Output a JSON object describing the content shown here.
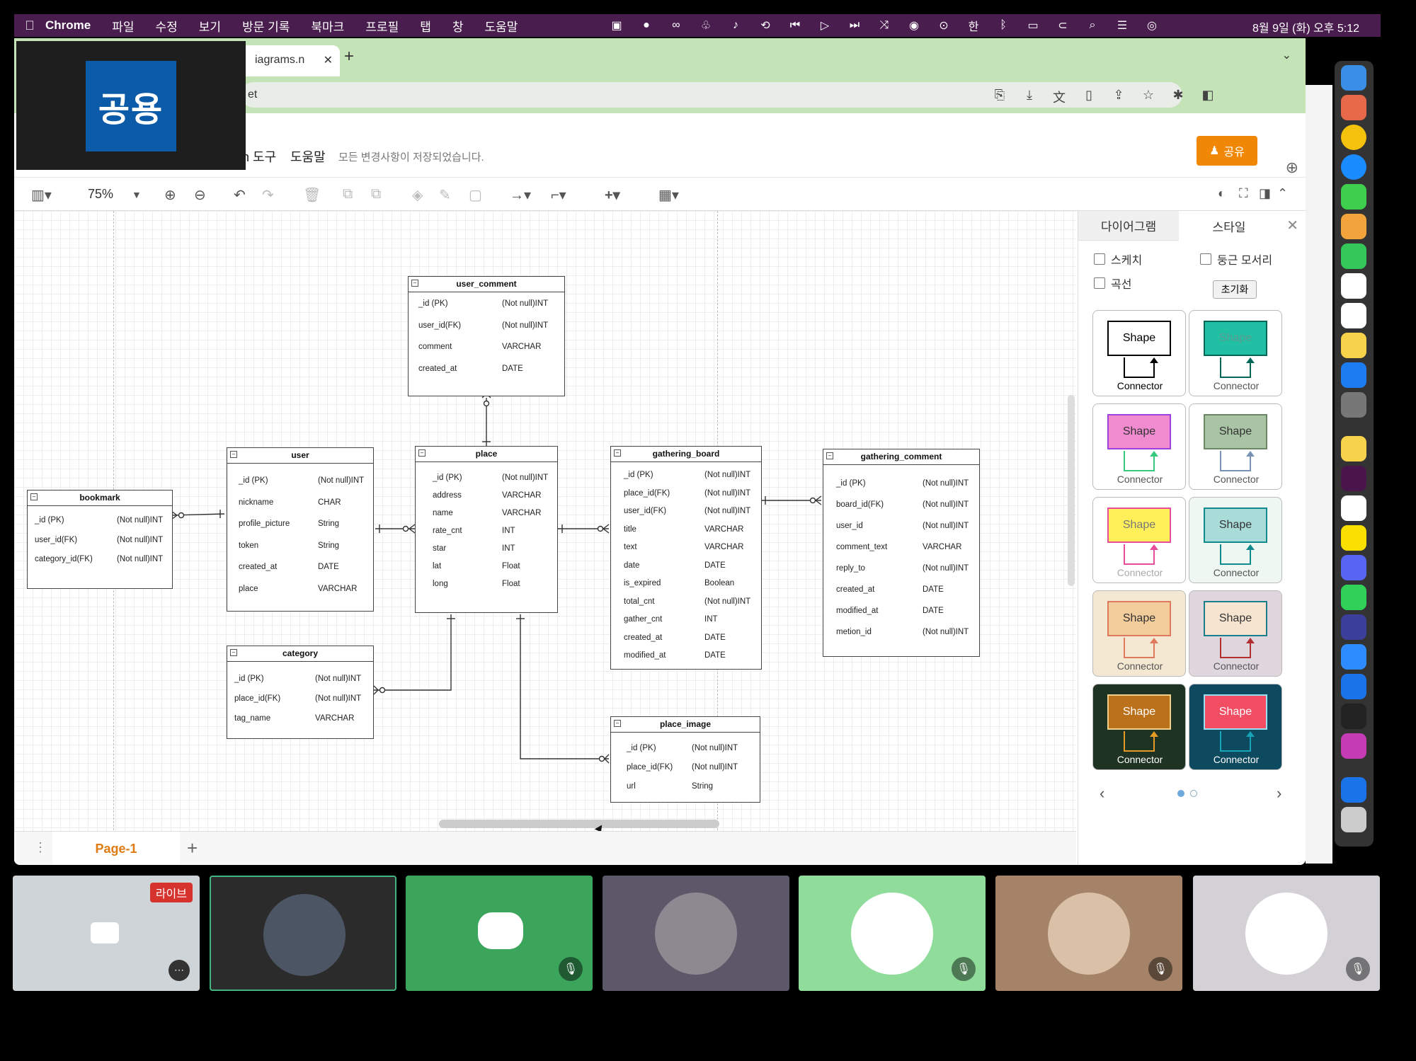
{
  "menubar": {
    "app": "Chrome",
    "items": [
      "파일",
      "수정",
      "보기",
      "방문 기록",
      "북마크",
      "프로필",
      "탭",
      "창",
      "도움말"
    ],
    "clock": "8월 9일 (화) 오후 5:12"
  },
  "browser": {
    "tab_title": "iagrams.n",
    "address": "et",
    "share_overlay": "공용"
  },
  "drawio": {
    "menu_tools": "h 도구",
    "menu_help": "도움말",
    "saved_status": "모든 변경사항이 저장되었습니다.",
    "share_button": "공유",
    "zoom": "75%",
    "page_tab": "Page-1"
  },
  "tables": {
    "user_comment": {
      "title": "user_comment",
      "rows": [
        [
          "_id (PK)",
          "(Not null)INT"
        ],
        [
          "user_id(FK)",
          "(Not null)INT"
        ],
        [
          "comment",
          "VARCHAR"
        ],
        [
          "created_at",
          "DATE"
        ]
      ]
    },
    "bookmark": {
      "title": "bookmark",
      "rows": [
        [
          "_id (PK)",
          "(Not null)INT"
        ],
        [
          "user_id(FK)",
          "(Not null)INT"
        ],
        [
          "category_id(FK)",
          "(Not null)INT"
        ]
      ]
    },
    "user": {
      "title": "user",
      "rows": [
        [
          "_id (PK)",
          "(Not null)INT"
        ],
        [
          "nickname",
          "CHAR"
        ],
        [
          "profile_picture",
          "String"
        ],
        [
          "token",
          "String"
        ],
        [
          "created_at",
          "DATE"
        ],
        [
          "place",
          "VARCHAR"
        ]
      ]
    },
    "place": {
      "title": "place",
      "rows": [
        [
          "_id (PK)",
          "(Not null)INT"
        ],
        [
          "address",
          "VARCHAR"
        ],
        [
          "name",
          "VARCHAR"
        ],
        [
          "rate_cnt",
          "INT"
        ],
        [
          "star",
          "INT"
        ],
        [
          "lat",
          "Float"
        ],
        [
          "long",
          "Float"
        ]
      ]
    },
    "gathering_board": {
      "title": "gathering_board",
      "rows": [
        [
          "_id (PK)",
          "(Not null)INT"
        ],
        [
          "place_id(FK)",
          "(Not null)INT"
        ],
        [
          "user_id(FK)",
          "(Not null)INT"
        ],
        [
          "title",
          "VARCHAR"
        ],
        [
          "text",
          "VARCHAR"
        ],
        [
          "date",
          "DATE"
        ],
        [
          "is_expired",
          "Boolean"
        ],
        [
          "total_cnt",
          "(Not null)INT"
        ],
        [
          "gather_cnt",
          "INT"
        ],
        [
          "created_at",
          "DATE"
        ],
        [
          "modified_at",
          "DATE"
        ]
      ]
    },
    "gathering_comment": {
      "title": "gathering_comment",
      "rows": [
        [
          "_id (PK)",
          "(Not null)INT"
        ],
        [
          "board_id(FK)",
          "(Not null)INT"
        ],
        [
          "user_id",
          "(Not null)INT"
        ],
        [
          "comment_text",
          "VARCHAR"
        ],
        [
          "reply_to",
          "(Not null)INT"
        ],
        [
          "created_at",
          "DATE"
        ],
        [
          "modified_at",
          "DATE"
        ],
        [
          "metion_id",
          "(Not null)INT"
        ]
      ]
    },
    "category": {
      "title": "category",
      "rows": [
        [
          "_id (PK)",
          "(Not null)INT"
        ],
        [
          "place_id(FK)",
          "(Not null)INT"
        ],
        [
          "tag_name",
          "VARCHAR"
        ]
      ]
    },
    "place_image": {
      "title": "place_image",
      "rows": [
        [
          "_id (PK)",
          "(Not null)INT"
        ],
        [
          "place_id(FK)",
          "(Not null)INT"
        ],
        [
          "url",
          "String"
        ]
      ]
    }
  },
  "panel": {
    "tab_diagram": "다이어그램",
    "tab_style": "스타일",
    "sketch": "스케치",
    "rounded": "둥근 모서리",
    "curved": "곡선",
    "reset": "초기화",
    "swatches": [
      {
        "shape": "Shape",
        "connector": "Connector",
        "bg": "#ffffff",
        "fill": "#ffffff",
        "stroke": "#000000",
        "text": "#000000",
        "line": "#000000",
        "ctext": "#000000"
      },
      {
        "shape": "Shape",
        "connector": "Connector",
        "bg": "#ffffff",
        "fill": "#21c0a5",
        "stroke": "#006658",
        "text": "#5c9a8f",
        "line": "#006658",
        "ctext": "#555555"
      },
      {
        "shape": "Shape",
        "connector": "Connector",
        "bg": "#ffffff",
        "fill": "#f08bcf",
        "stroke": "#a03fd9",
        "text": "#333333",
        "line": "#36c97d",
        "ctext": "#555555"
      },
      {
        "shape": "Shape",
        "connector": "Connector",
        "bg": "#ffffff",
        "fill": "#a9c4a4",
        "stroke": "#6d8764",
        "text": "#333333",
        "line": "#7891b5",
        "ctext": "#555555"
      },
      {
        "shape": "Shape",
        "connector": "Connector",
        "bg": "#ffffff",
        "fill": "#fff05a",
        "stroke": "#e74d9b",
        "text": "#777777",
        "line": "#e74d9b",
        "ctext": "#aaaaaa"
      },
      {
        "shape": "Shape",
        "connector": "Connector",
        "bg": "#eef7f1",
        "fill": "#a9dcd9",
        "stroke": "#0f8b8d",
        "text": "#333333",
        "line": "#0f8b8d",
        "ctext": "#555555"
      },
      {
        "shape": "Shape",
        "connector": "Connector",
        "bg": "#f5e8d2",
        "fill": "#f2cc9a",
        "stroke": "#e07a5f",
        "text": "#333333",
        "line": "#e07a5f",
        "ctext": "#555555"
      },
      {
        "shape": "Shape",
        "connector": "Connector",
        "bg": "#e0d6dd",
        "fill": "#f6e4d1",
        "stroke": "#1a7f8a",
        "text": "#333333",
        "line": "#b22e30",
        "ctext": "#555555"
      },
      {
        "shape": "Shape",
        "connector": "Connector",
        "bg": "#1f3323",
        "fill": "#bb701a",
        "stroke": "#f0d08a",
        "text": "#ffffff",
        "line": "#e59b26",
        "ctext": "#ffffff"
      },
      {
        "shape": "Shape",
        "connector": "Connector",
        "bg": "#0d4a5f",
        "fill": "#f24d63",
        "stroke": "#9be0f0",
        "text": "#ffffff",
        "line": "#17a3b8",
        "ctext": "#ffffff"
      }
    ]
  },
  "meet": {
    "live_badge": "라이브"
  },
  "colors": {
    "menubar": "#4a1d4f",
    "tabbar": "#c4e3b6",
    "share": "#f08705",
    "page_tab": "#e07b12"
  }
}
